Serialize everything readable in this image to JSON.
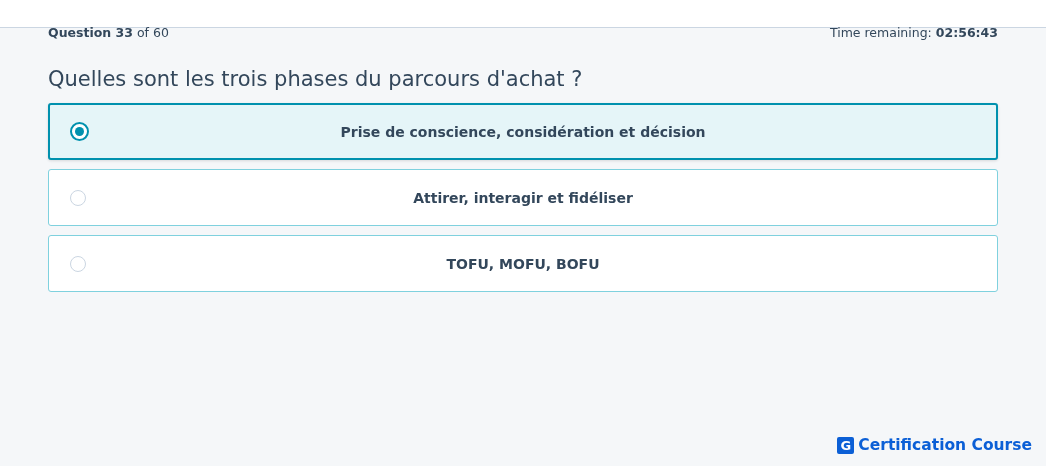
{
  "progress": "**Question 33** of 60",
  "timer": "Time remaining: **02:56:43**",
  "question": "Quelles sont les trois phases du parcours d'achat ?",
  "options": [
    {
      "label": "Prise de conscience, considération et décision",
      "selected": true
    },
    {
      "label": "Attirer, interagir et fidéliser",
      "selected": false
    },
    {
      "label": "TOFU, MOFU, BOFU",
      "selected": false
    }
  ],
  "brand": {
    "mark": "G",
    "name": "Certification Course"
  }
}
